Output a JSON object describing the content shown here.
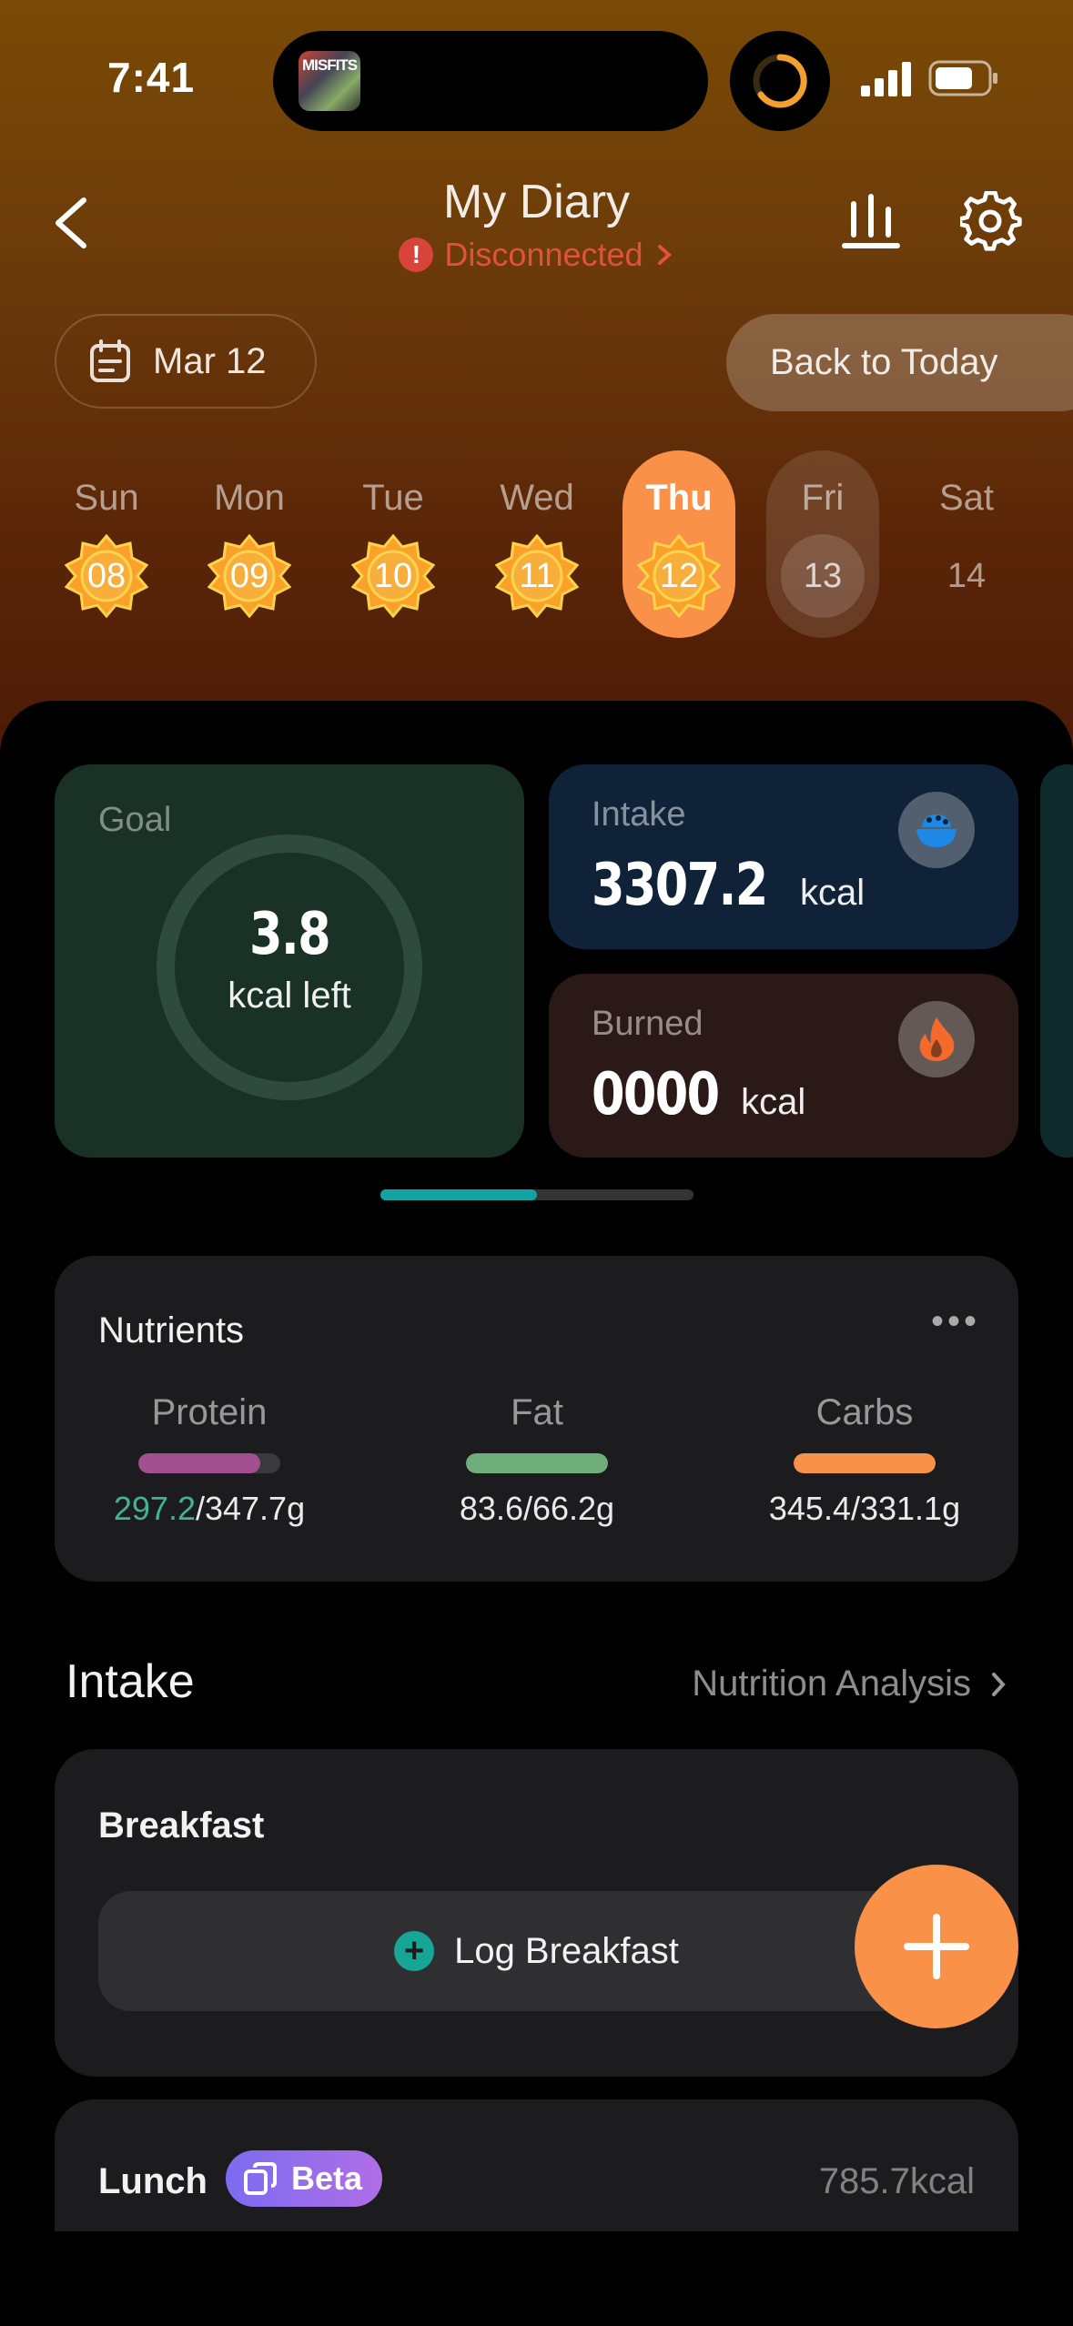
{
  "status_bar": {
    "time": "7:41",
    "now_playing_art": "MISFITS"
  },
  "header": {
    "title": "My Diary",
    "connection_status": "Disconnected",
    "back_icon": "chevron-left-icon",
    "stats_icon": "bar-chart-icon",
    "settings_icon": "gear-icon"
  },
  "date_bar": {
    "selected_date": "Mar 12",
    "back_to_today": "Back to Today"
  },
  "week": [
    {
      "name": "Sun",
      "num": "08",
      "state": "done"
    },
    {
      "name": "Mon",
      "num": "09",
      "state": "done"
    },
    {
      "name": "Tue",
      "num": "10",
      "state": "done"
    },
    {
      "name": "Wed",
      "num": "11",
      "state": "done"
    },
    {
      "name": "Thu",
      "num": "12",
      "state": "selected"
    },
    {
      "name": "Fri",
      "num": "13",
      "state": "today"
    },
    {
      "name": "Sat",
      "num": "14",
      "state": "future"
    }
  ],
  "summary": {
    "goal": {
      "label": "Goal",
      "value": "3.8",
      "sub": "kcal left"
    },
    "intake": {
      "label": "Intake",
      "value": "3307.2",
      "unit": "kcal"
    },
    "burned": {
      "label": "Burned",
      "value": "0000",
      "unit": "kcal"
    },
    "pager_progress": 0.5
  },
  "nutrients": {
    "title": "Nutrients",
    "items": [
      {
        "name": "Protein",
        "current": "297.2",
        "total": "/347.7g",
        "fill": 0.86,
        "color": "#a2508f",
        "highlight": true
      },
      {
        "name": "Fat",
        "current": "83.6",
        "total": "/66.2g",
        "fill": 1.0,
        "color": "#6fae7b",
        "highlight": false
      },
      {
        "name": "Carbs",
        "current": "345.4",
        "total": "/331.1g",
        "fill": 1.0,
        "color": "#f99148",
        "highlight": false
      }
    ]
  },
  "intake_section": {
    "title": "Intake",
    "analysis_link": "Nutrition Analysis",
    "breakfast": {
      "title": "Breakfast",
      "log_label": "Log Breakfast"
    },
    "lunch": {
      "title": "Lunch",
      "badge": "Beta",
      "kcal": "785.7kcal"
    }
  },
  "colors": {
    "accent": "#f99148",
    "teal": "#14a3a3",
    "disconnected": "#e2503e"
  }
}
